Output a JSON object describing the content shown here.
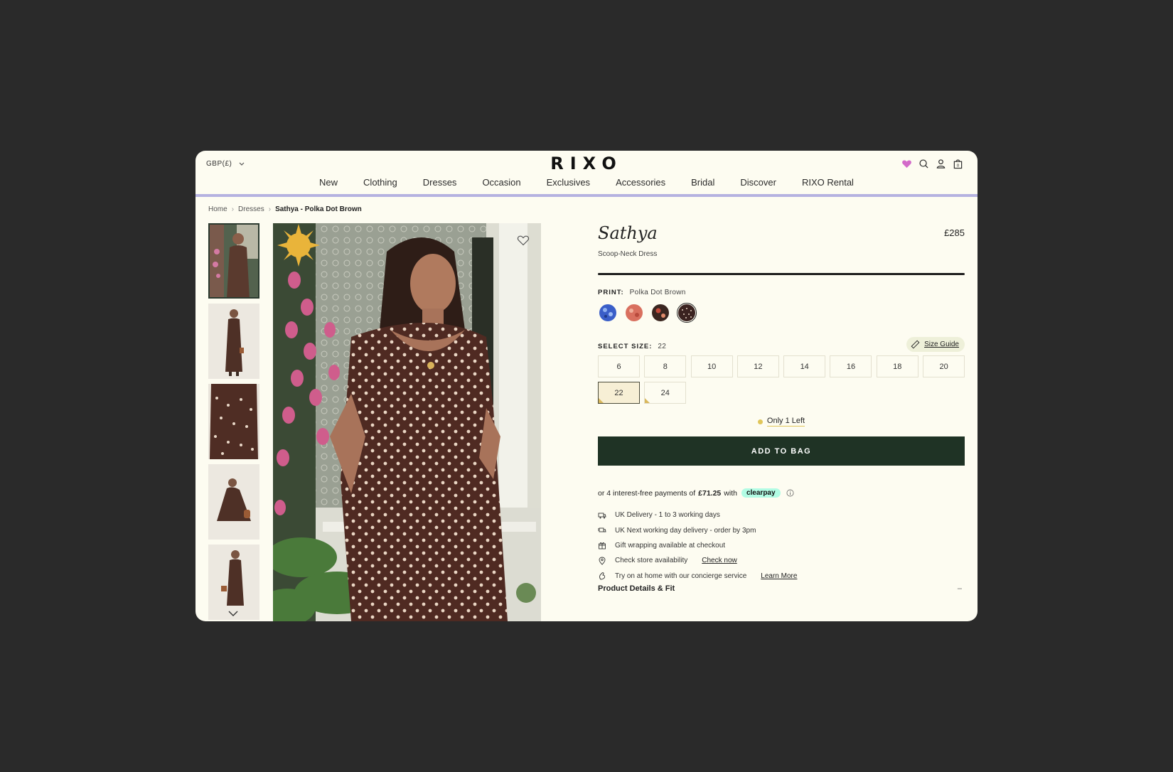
{
  "header": {
    "currency": "GBP(£)",
    "logo": "RIXO",
    "icons": [
      "heart-icon",
      "search-icon",
      "account-icon",
      "bag-icon"
    ],
    "accent_color": "#b5b2e0"
  },
  "nav": {
    "items": [
      "New",
      "Clothing",
      "Dresses",
      "Occasion",
      "Exclusives",
      "Accessories",
      "Bridal",
      "Discover",
      "RIXO Rental"
    ]
  },
  "breadcrumb": {
    "home": "Home",
    "category": "Dresses",
    "current": "Sathya - Polka Dot Brown"
  },
  "product": {
    "title": "Sathya",
    "price": "£285",
    "subtitle": "Scoop-Neck Dress",
    "print_label": "PRINT:",
    "print_value": "Polka Dot Brown",
    "swatches": [
      "blue floral",
      "red floral",
      "dark floral",
      "polka dot brown"
    ],
    "size_label": "SELECT SIZE:",
    "size_value": "22",
    "size_guide": "Size Guide",
    "sizes": [
      "6",
      "8",
      "10",
      "12",
      "14",
      "16",
      "18",
      "20",
      "22",
      "24"
    ],
    "selected_size": "22",
    "stock": "Only 1 Left",
    "add_to_bag": "ADD TO BAG",
    "payment": {
      "prefix": "or 4 interest-free payments of",
      "amount": "£71.25",
      "with": "with",
      "provider": "clearpay"
    },
    "features": [
      {
        "icon": "delivery-icon",
        "text": "UK Delivery - 1 to 3 working days",
        "link": ""
      },
      {
        "icon": "express-delivery-icon",
        "text": "UK Next working day delivery - order by 3pm",
        "link": ""
      },
      {
        "icon": "gift-icon",
        "text": "Gift wrapping available at checkout",
        "link": ""
      },
      {
        "icon": "location-icon",
        "text": "Check store availability",
        "link": "Check now"
      },
      {
        "icon": "concierge-icon",
        "text": "Try on at home with our concierge service",
        "link": "Learn More"
      }
    ],
    "details_heading": "Product Details & Fit",
    "details_toggle": "–"
  }
}
